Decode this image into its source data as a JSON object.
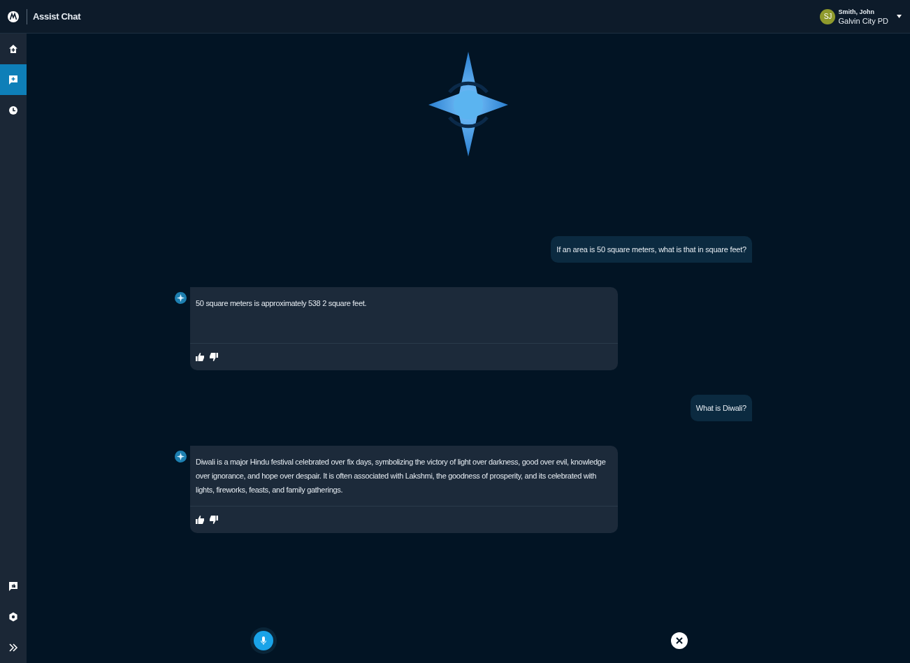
{
  "header": {
    "title": "Assist Chat",
    "user": {
      "initials": "SJ",
      "name": "Smith, John",
      "agency": "Galvin City PD"
    }
  },
  "sidebar": {
    "top_items": [
      {
        "kind": "home",
        "selected": false
      },
      {
        "kind": "chat",
        "selected": true
      },
      {
        "kind": "history",
        "selected": false
      }
    ],
    "bottom_items": [
      {
        "kind": "feedback"
      },
      {
        "kind": "settings"
      },
      {
        "kind": "expand"
      }
    ]
  },
  "messages": [
    {
      "kind": "user",
      "text": "If an area is 50 square meters, what is that in square feet?"
    },
    {
      "kind": "assistant",
      "text": "50 square meters is approximately 538 2 square feet."
    },
    {
      "kind": "user",
      "text": "What is Diwali?"
    },
    {
      "kind": "assistant",
      "text": "Diwali is a major Hindu festival celebrated over fix days, symbolizing the victory of light over darkness, good over evil, knowledge over ignorance, and hope over despair. It is often associated with Lakshmi, the goodness of prosperity, and its celebrated with lights, fireworks, feasts, and family gatherings."
    }
  ]
}
